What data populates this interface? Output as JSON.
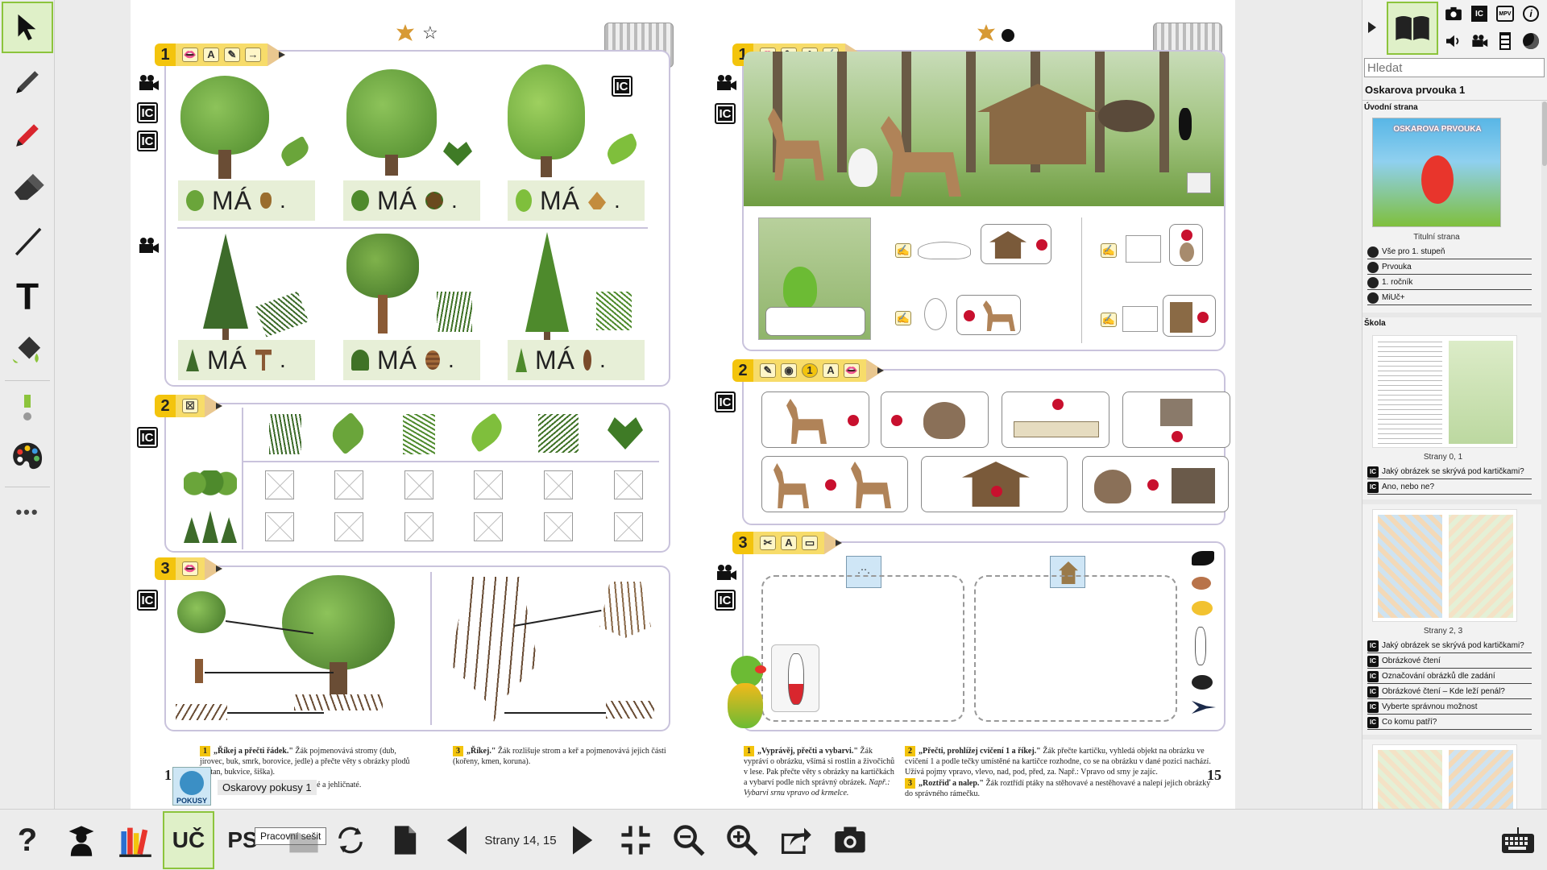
{
  "toolbar_left": {
    "text_tool_glyph": "T",
    "more_glyph": "•••",
    "tools": [
      "pointer-icon",
      "pencil-icon",
      "marker-icon",
      "eraser-icon",
      "line-icon",
      "text-icon",
      "fill-icon",
      "size-icon",
      "palette-icon",
      "more-icon"
    ]
  },
  "book": {
    "left_page": {
      "page_number": "1",
      "ex1": {
        "num": "1",
        "ma_text": [
          "MÁ",
          "MÁ",
          "MÁ",
          "MÁ",
          "MÁ",
          "MÁ"
        ],
        "pencil_letter": "A"
      },
      "ex2": {
        "num": "2"
      },
      "ex3": {
        "num": "3"
      },
      "notes": [
        {
          "num": "1",
          "bold": "„Říkej a přečti řádek.\"",
          "text": " Žák pojmenovává stromy (dub, jírovec, buk, smrk, borovice, jedle) a přečte věty s obrázky plodů kaštan, bukvice, šiška)."
        },
        {
          "num": "",
          "bold": "",
          "text": "šiuje stromy listnaté a jehličnaté."
        },
        {
          "num": "3",
          "bold": "„Říkej.\"",
          "text": " Žák rozlišuje strom a keř a pojmenovává jejich části (kořeny, kmen, koruna)."
        }
      ],
      "pokusy_badge": "POKUSY",
      "pokusy_label": "Oskarovy pokusy 1"
    },
    "right_page": {
      "page_number": "15",
      "ex1": {
        "num": "1",
        "pencil_letter": "A"
      },
      "ex2": {
        "num": "2",
        "pencil_num": "1",
        "pencil_letter": "A"
      },
      "ex3": {
        "num": "3",
        "pencil_letter": "A"
      },
      "notes": [
        {
          "num": "1",
          "bold": "„Vyprávěj, přečti a vybarvi.\"",
          "text": " Žák vypráví o obrázku, všímá si rostlin a živočichů v lese. Pak přečte věty s obrázky na kartičkách a vybarví podle nich správný obrázek.",
          "example": "Např.: Vybarvi srnu vpravo od krmelce."
        },
        {
          "num": "2",
          "bold": "„Přečti, prohlížej cvičení 1 a říkej.\"",
          "text": " Žák přečte kartičku, vyhledá objekt na obrázku ve cvičení 1 a podle tečky umístěné na kartičce rozhodne, co se na obrázku v dané pozici nachází. Užívá pojmy vpravo, vlevo, nad, pod, před, za. Např.: Vpravo od srny je zajíc."
        },
        {
          "num": "3",
          "bold": "„Roztřiď a nalep.\"",
          "text": " Žák roztřídí ptáky na stěhovavé a nestěhovavé a nalepí jejich obrázky do správného rámečku."
        }
      ]
    },
    "ic_label": "IC"
  },
  "right_panel": {
    "search_placeholder": "Hledat",
    "book_title": "Oskarova prvouka 1",
    "sections": [
      {
        "header": "Úvodní strana",
        "thumb_label": "Titulní strana",
        "cover_title": "OSKAROVA PRVOUKA",
        "links": [
          {
            "icon": "globe",
            "label": "Vše pro 1. stupeň"
          },
          {
            "icon": "globe",
            "label": "Prvouka"
          },
          {
            "icon": "globe",
            "label": "1. ročník"
          },
          {
            "icon": "globe",
            "label": "MiUč+"
          }
        ]
      },
      {
        "header": "Škola",
        "thumb_label": "Strany 0, 1",
        "links": [
          {
            "icon": "ic",
            "label": "Jaký obrázek se skrývá pod kartičkami?"
          },
          {
            "icon": "ic",
            "label": "Ano, nebo ne?"
          }
        ]
      },
      {
        "header": "",
        "thumb_label": "Strany 2, 3",
        "links": [
          {
            "icon": "ic",
            "label": "Jaký obrázek se skrývá pod kartičkami?"
          },
          {
            "icon": "ic",
            "label": "Obrázkové čtení"
          },
          {
            "icon": "ic",
            "label": "Označování obrázků dle zadání"
          },
          {
            "icon": "ic",
            "label": "Obrázkové čtení – Kde leží penál?"
          },
          {
            "icon": "ic",
            "label": "Vyberte správnou možnost"
          },
          {
            "icon": "ic",
            "label": "Co komu patří?"
          }
        ]
      }
    ]
  },
  "toolbar_bottom": {
    "help": "?",
    "uc_label": "UČ",
    "ps_label": "PS",
    "tooltip": "Pracovní sešit",
    "pages_label": "Strany 14, 15"
  },
  "colors": {
    "accent": "#8cc43c",
    "pencil": "#f3c40d",
    "frame": "#c9c3dc",
    "dot": "#c8102e"
  }
}
